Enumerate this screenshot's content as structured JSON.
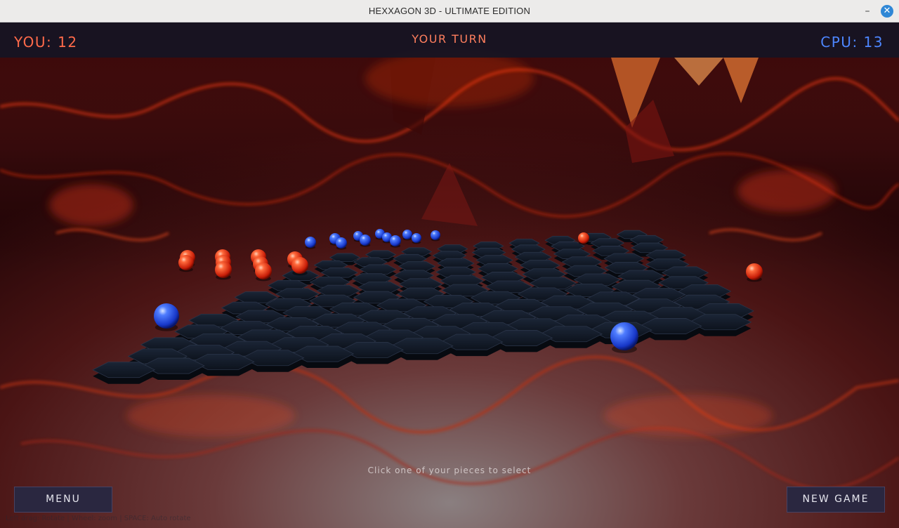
{
  "window": {
    "title": "HEXXAGON 3D - ULTIMATE EDITION",
    "minimize_glyph": "–",
    "close_glyph": "✕"
  },
  "hud": {
    "you_score": "YOU: 12",
    "turn_status": "YOUR TURN",
    "cpu_score": "CPU: 13"
  },
  "hint": "Click one of your pieces to select",
  "controls_hint": "Left drag: Rotate | Wheel: zoom | SPACE: Auto rotate",
  "buttons": {
    "menu": "MENU",
    "new_game": "NEW GAME"
  },
  "colors": {
    "player": "#ff5a36",
    "cpu": "#3b6cff",
    "board": "#141b28",
    "hud_bg": "#16142a"
  },
  "icons": {
    "minimize": "minimize-icon",
    "close": "close-icon"
  }
}
